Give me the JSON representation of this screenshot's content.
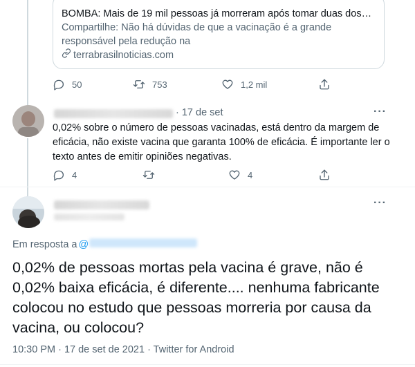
{
  "quoted_card": {
    "headline": "BOMBA: Mais de 19 mil pessoas já morreram após tomar duas dose…",
    "description": "Compartilhe: Não há dúvidas de que a vacinação é a grande responsável pela redução na",
    "link": "terrabrasilnoticias.com"
  },
  "first_tweet_actions": {
    "replies": "50",
    "retweets": "753",
    "likes": "1,2 mil"
  },
  "reply_tweet": {
    "date": "· 17 de set",
    "text": "0,02% sobre o número de pessoas vacinadas, está dentro da margem de eficácia, não existe vacina que garanta 100% de eficácia. É importante ler o texto antes de emitir opiniões negativas.",
    "replies": "4",
    "likes": "4"
  },
  "main_tweet": {
    "in_reply_label": "Em resposta a",
    "at_sign": "@",
    "text": "0,02% de pessoas mortas pela vacina é grave, não é 0,02% baixa eficácia, é diferente.... nenhuma fabricante colocou no estudo que pessoas morreria por causa da vacina, ou colocou?",
    "timestamp": "10:30 PM · 17 de set de 2021 · Twitter for Android"
  },
  "icons": {
    "reply": "reply-icon",
    "retweet": "retweet-icon",
    "like": "heart-icon",
    "share": "share-icon",
    "link": "link-icon",
    "more": "more-icon"
  },
  "colors": {
    "link_blue": "#1d9bf0",
    "secondary_text": "#536471",
    "border": "#cfd9de"
  }
}
